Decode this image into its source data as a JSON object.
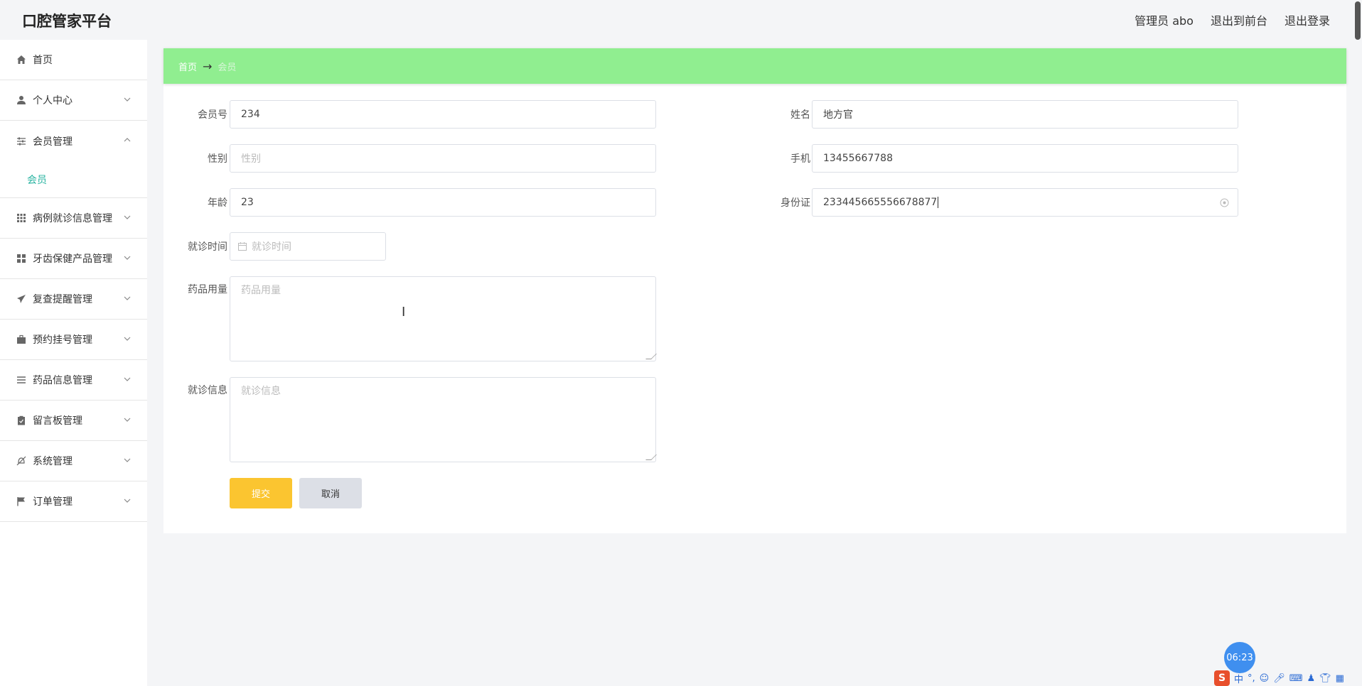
{
  "header": {
    "brand": "口腔管家平台",
    "user_label": "管理员 abo",
    "to_front": "退出到前台",
    "logout": "退出登录"
  },
  "sidebar": {
    "items": [
      {
        "label": "首页",
        "icon": "home-icon"
      },
      {
        "label": "个人中心",
        "icon": "user-icon"
      },
      {
        "label": "会员管理",
        "icon": "sliders-icon"
      },
      {
        "label": "病例就诊信息管理",
        "icon": "grid-icon"
      },
      {
        "label": "牙齿保健产品管理",
        "icon": "apps-icon"
      },
      {
        "label": "复查提醒管理",
        "icon": "paper-plane-icon"
      },
      {
        "label": "预约挂号管理",
        "icon": "briefcase-icon"
      },
      {
        "label": "药品信息管理",
        "icon": "list-icon"
      },
      {
        "label": "留言板管理",
        "icon": "clipboard-icon"
      },
      {
        "label": "系统管理",
        "icon": "bell-off-icon"
      },
      {
        "label": "订单管理",
        "icon": "flag-icon"
      }
    ],
    "submenu": {
      "label": "会员"
    }
  },
  "breadcrumb": {
    "home": "首页",
    "separator": "→",
    "current": "会员"
  },
  "form": {
    "member_no": {
      "label": "会员号",
      "value": "234"
    },
    "name": {
      "label": "姓名",
      "value": "地方官"
    },
    "gender": {
      "label": "性别",
      "placeholder": "性别"
    },
    "phone": {
      "label": "手机",
      "value": "13455667788"
    },
    "age": {
      "label": "年龄",
      "value": "23"
    },
    "id_card": {
      "label": "身份证",
      "value": "233445665556678877"
    },
    "visit_time": {
      "label": "就诊时间",
      "placeholder": "就诊时间"
    },
    "dosage": {
      "label": "药品用量",
      "placeholder": "药品用量"
    },
    "visit_info": {
      "label": "就诊信息",
      "placeholder": "就诊信息"
    },
    "submit": "提交",
    "cancel": "取消"
  },
  "widgets": {
    "timer": "06:23",
    "ime_logo": "S",
    "ime_mode": "中"
  },
  "colors": {
    "breadcrumb_bg": "#90ee90",
    "submit": "#fbc530",
    "active_submenu": "#27b3a0"
  }
}
